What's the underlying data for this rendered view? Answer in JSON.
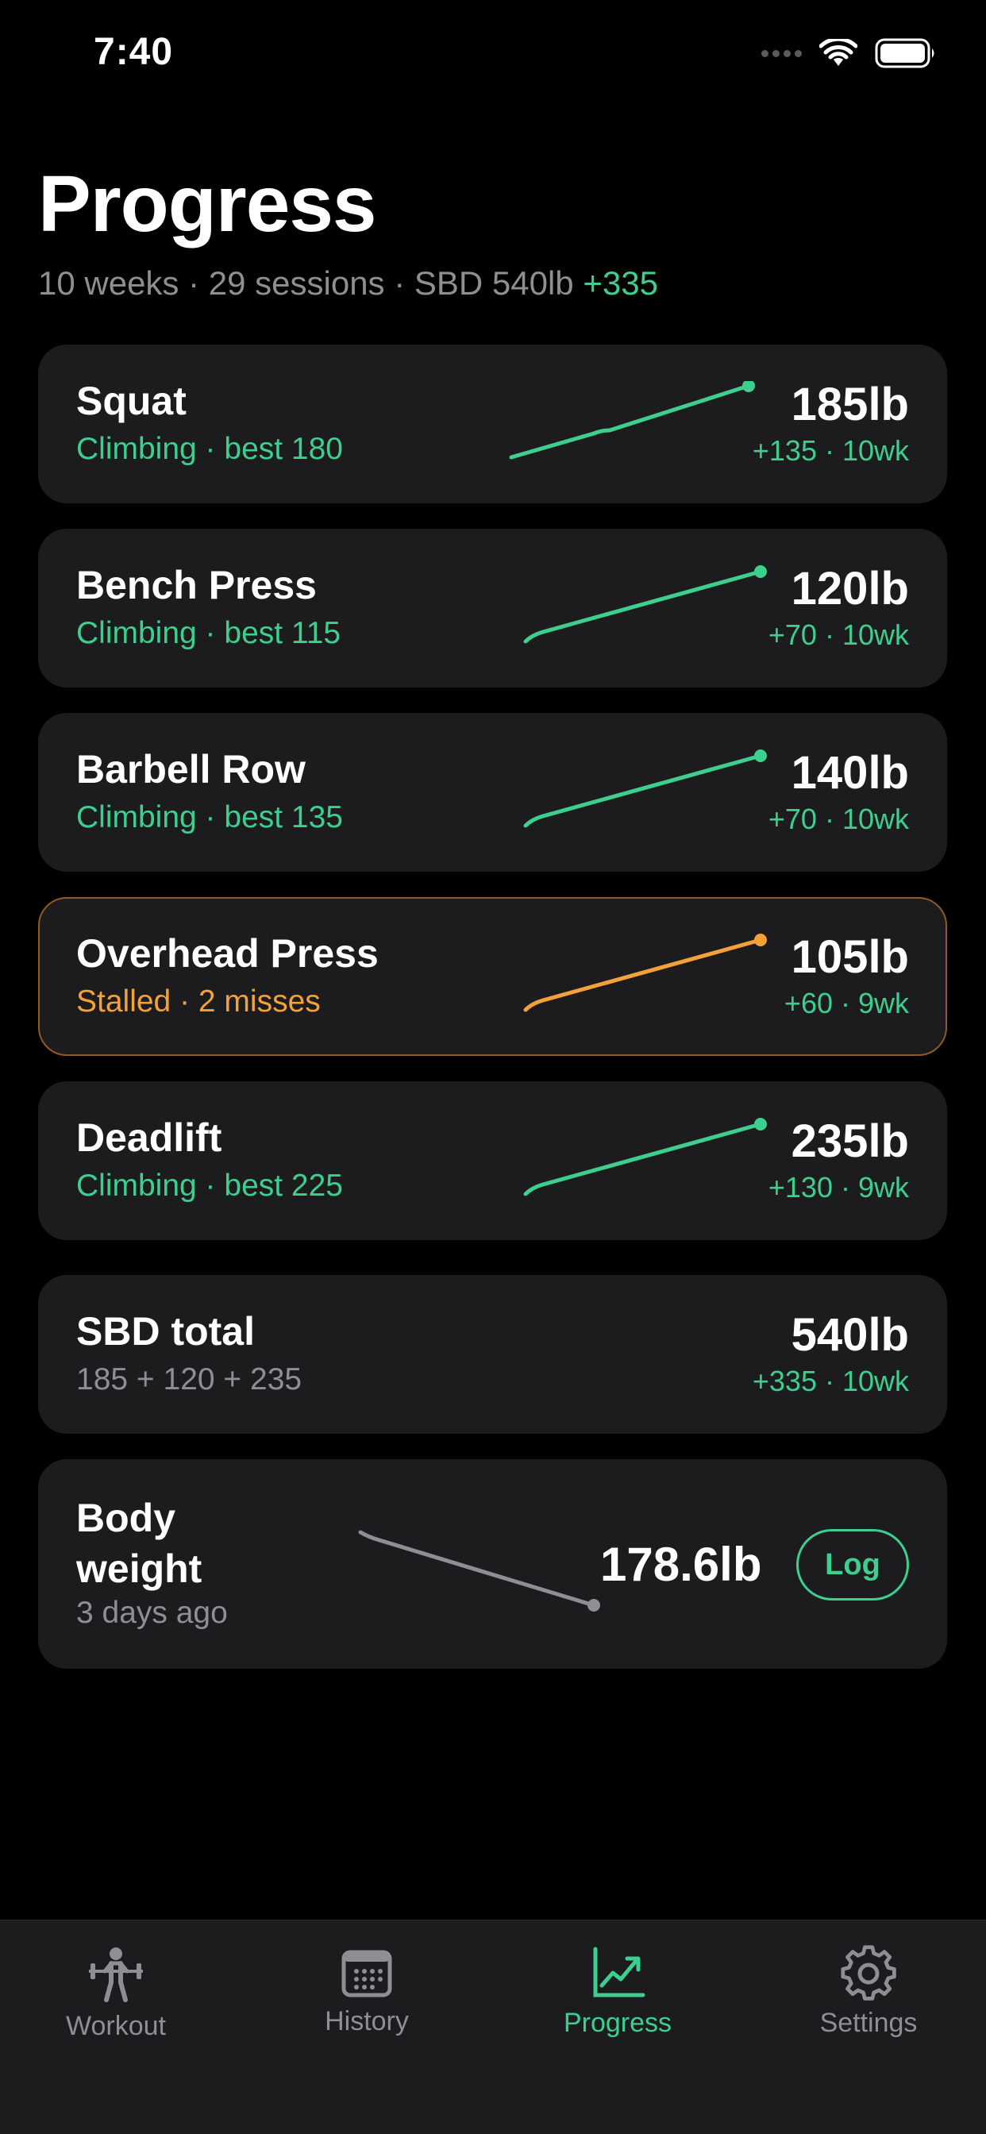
{
  "status_bar": {
    "time": "7:40"
  },
  "header": {
    "title": "Progress",
    "summary_text": "10 weeks · 29 sessions · SBD 540lb",
    "summary_accent": "+335"
  },
  "lifts": [
    {
      "name": "Squat",
      "status": "Climbing · best 180",
      "value": "185lb",
      "delta": "+135 · 10wk",
      "state": "climbing"
    },
    {
      "name": "Bench Press",
      "status": "Climbing · best 115",
      "value": "120lb",
      "delta": "+70 · 10wk",
      "state": "climbing"
    },
    {
      "name": "Barbell Row",
      "status": "Climbing · best 135",
      "value": "140lb",
      "delta": "+70 · 10wk",
      "state": "climbing"
    },
    {
      "name": "Overhead Press",
      "status": "Stalled · 2 misses",
      "value": "105lb",
      "delta": "+60 · 9wk",
      "state": "stalled"
    },
    {
      "name": "Deadlift",
      "status": "Climbing · best 225",
      "value": "235lb",
      "delta": "+130 · 9wk",
      "state": "climbing"
    }
  ],
  "sbd_total": {
    "name": "SBD total",
    "formula": "185 + 120 + 235",
    "value": "540lb",
    "delta": "+335 · 10wk"
  },
  "body_weight": {
    "name": "Body weight",
    "when": "3 days ago",
    "value": "178.6lb",
    "log_label": "Log"
  },
  "tabs": [
    {
      "label": "Workout",
      "icon": "weightlifter-icon",
      "active": false
    },
    {
      "label": "History",
      "icon": "calendar-icon",
      "active": false
    },
    {
      "label": "Progress",
      "icon": "chart-trend-icon",
      "active": true
    },
    {
      "label": "Settings",
      "icon": "gear-icon",
      "active": false
    }
  ],
  "colors": {
    "accent": "#3ccf8e",
    "warning": "#f5a13a",
    "card": "#1c1c1e",
    "muted": "#8e8e93"
  }
}
